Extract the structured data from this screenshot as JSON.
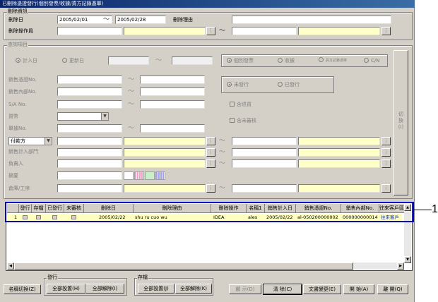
{
  "window": {
    "title": "已刪除憑證發行(個別發票/收據/貨方記錄憑單)"
  },
  "delete_info": {
    "legend": "刪除資訊",
    "date_label": "刪除日",
    "date_from": "2005/02/01",
    "date_to": "2005/02/28",
    "tilde": "〜",
    "reason_label": "刪除理由",
    "reason_value": "",
    "operator_label": "刪除操作員",
    "operator_from": "",
    "operator_from_name": "",
    "operator_to": "",
    "operator_to_name": ""
  },
  "query": {
    "legend": "查詢項目",
    "radio_input_date": "計入日",
    "radio_update_date": "更新日",
    "radio_individual": "個別發票",
    "radio_receipt": "收據",
    "radio_credit": "貨方記錄憑單",
    "radio_cn": "C/N",
    "radio_not_issued": "未發行",
    "radio_issued": "已發行",
    "check_include_returns": "含退貨",
    "check_include_unreviewed": "含未審核",
    "sales_slip_label": "銷售憑證No.",
    "sales_internal_label": "銷售內部No.",
    "sa_label": "S/A No.",
    "currency_label": "貨幣",
    "order_label": "單據No.",
    "payer_combo": "付款方",
    "sales_dept_label": "銷售計入部門",
    "person_label": "負責人",
    "summary_label": "摘要",
    "warehouse_label": "倉庫/工序",
    "toggle_label": "切換(I)"
  },
  "grid": {
    "headers": [
      "",
      "發行",
      "存檔",
      "已發行",
      "未審核",
      "刪除日",
      "刪除理由",
      "刪除操作",
      "名稱1",
      "銷售計入日",
      "銷售憑證No.",
      "銷售內部No.",
      "往來客戶區"
    ],
    "rows": [
      {
        "no": "1",
        "delete_date": "2005/02/22",
        "reason": "shu ru cuo wu",
        "operator": "IDEA",
        "name1": "ales",
        "sales_date": "2005/02/22",
        "slip_no": "al-050200000002",
        "internal_no": "000000000014",
        "customer": "往來客戶"
      }
    ]
  },
  "bottom": {
    "name_toggle": "名稱切換(Z)",
    "issue_group": "發行",
    "issue_all": "全部設置(H)",
    "issue_clear": "全部解除(I)",
    "archive_group": "存檔",
    "archive_all": "全部設置(J)",
    "archive_clear": "全部解除(K)",
    "display": "顯 示(D)",
    "clear": "清 除(C)",
    "doc_change": "文書變更(E)",
    "start": "開 始(A)",
    "close": "離 開(Q)"
  },
  "annotation": {
    "label": "1"
  },
  "colors": {
    "highlight_box": "#0000cc",
    "required_field": "#ffffc8",
    "selected_row": "#ffffc0"
  }
}
